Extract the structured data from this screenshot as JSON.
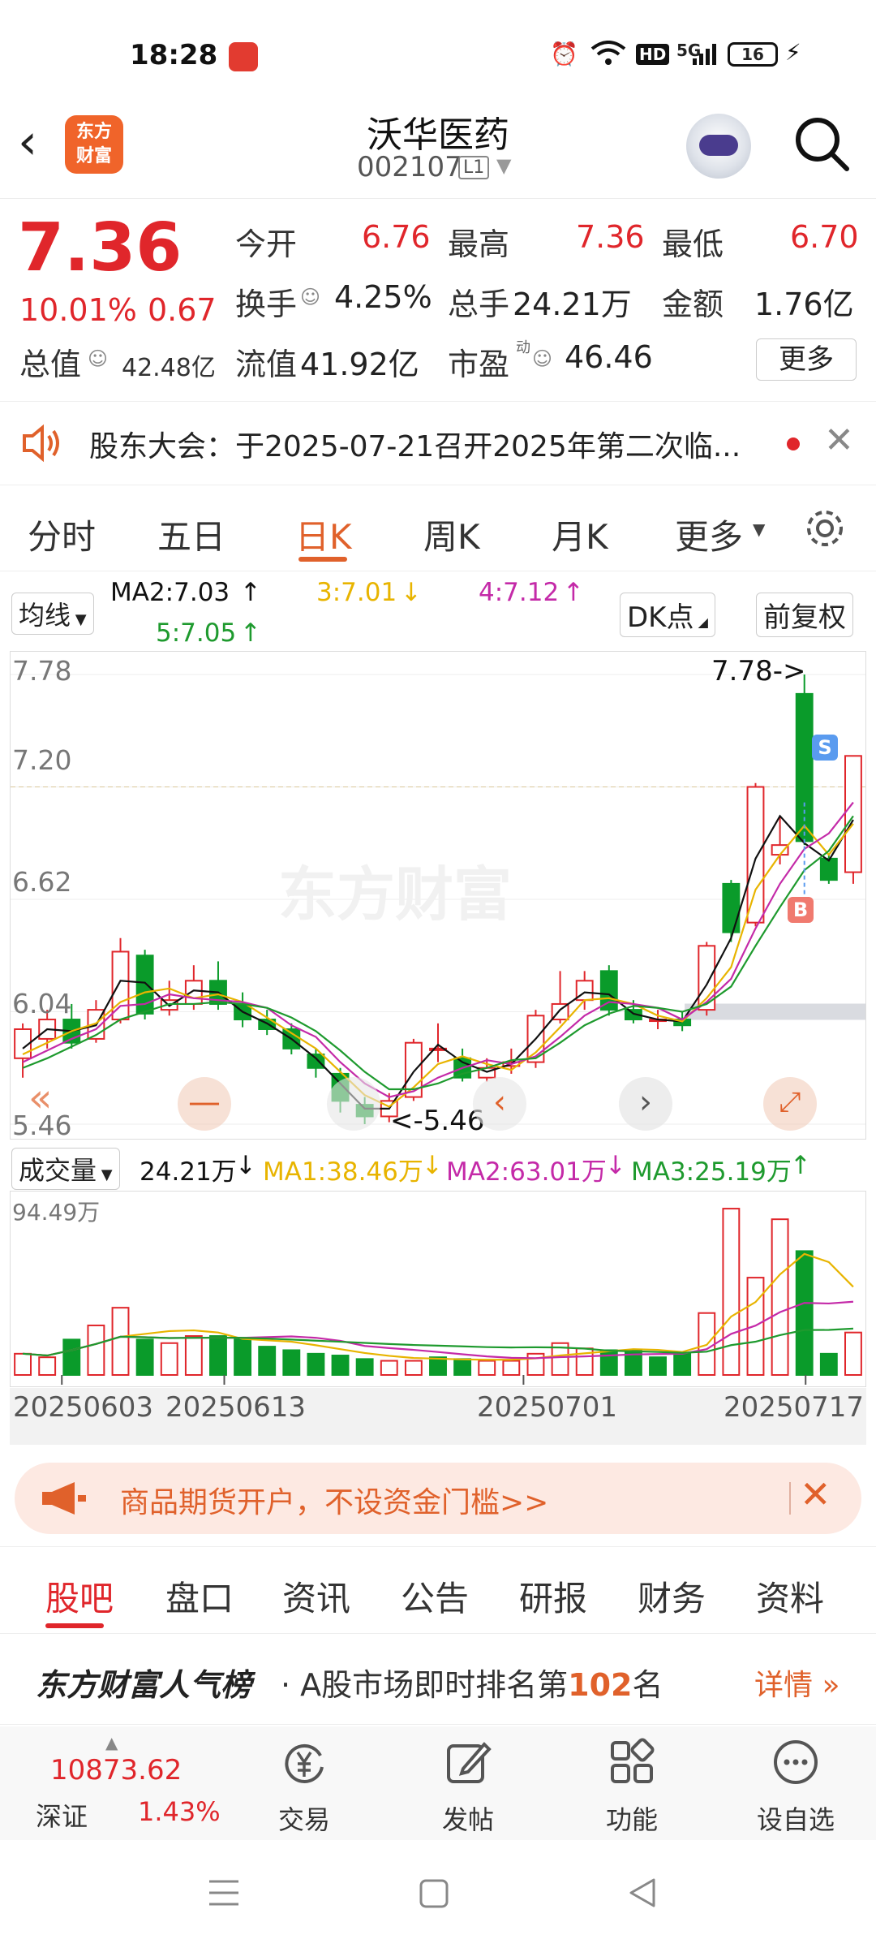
{
  "status_bar": {
    "time": "18:28",
    "network": "5G",
    "hd": "HD",
    "battery": "16"
  },
  "header": {
    "stock_name": "沃华医药",
    "stock_code": "002107",
    "level_badge": "L1",
    "logo_text_1": "东方",
    "logo_text_2": "财富"
  },
  "quote": {
    "price": "7.36",
    "change_pct": "10.01%",
    "change": "0.67",
    "market_cap_label": "总值",
    "market_cap": "42.48亿",
    "open_label": "今开",
    "open": "6.76",
    "high_label": "最高",
    "high": "7.36",
    "low_label": "最低",
    "low": "6.70",
    "turnover_label": "换手",
    "turnover": "4.25%",
    "volume_label": "总手",
    "volume": "24.21万",
    "amount_label": "金额",
    "amount": "1.76亿",
    "float_cap_label": "流值",
    "float_cap": "41.92亿",
    "pe_label": "市盈",
    "pe_sup": "动",
    "pe": "46.46",
    "more_label": "更多"
  },
  "notice": {
    "text": "股东大会：于2025-07-21召开2025年第二次临..."
  },
  "tabs": [
    {
      "label": "分时"
    },
    {
      "label": "五日"
    },
    {
      "label": "日K"
    },
    {
      "label": "周K"
    },
    {
      "label": "月K"
    },
    {
      "label": "更多"
    }
  ],
  "chart_toolbar": {
    "ma_selector": "均线",
    "ma2": "MA2:7.03",
    "ma3": "3:7.01",
    "ma4": "4:7.12",
    "ma5": "5:7.05",
    "dk_button": "DK点",
    "adjust_button": "前复权"
  },
  "chart_data": {
    "type": "candlestick",
    "y_axis_labels": [
      "7.78",
      "7.20",
      "6.62",
      "6.04",
      "5.46"
    ],
    "ylim": [
      5.46,
      7.78
    ],
    "high_marker": "7.78->",
    "low_marker": "<-5.46",
    "buy_marker": "B",
    "sell_marker": "S",
    "watermark": "东方财富",
    "candles": [
      {
        "o": 5.8,
        "c": 5.95,
        "h": 5.98,
        "l": 5.7
      },
      {
        "o": 5.9,
        "c": 6.0,
        "h": 6.05,
        "l": 5.85
      },
      {
        "o": 6.0,
        "c": 5.88,
        "h": 6.08,
        "l": 5.85
      },
      {
        "o": 5.9,
        "c": 6.05,
        "h": 6.1,
        "l": 5.88
      },
      {
        "o": 6.0,
        "c": 6.35,
        "h": 6.42,
        "l": 5.98
      },
      {
        "o": 6.33,
        "c": 6.03,
        "h": 6.36,
        "l": 6.0
      },
      {
        "o": 6.05,
        "c": 6.1,
        "h": 6.2,
        "l": 6.02
      },
      {
        "o": 6.08,
        "c": 6.2,
        "h": 6.28,
        "l": 6.05
      },
      {
        "o": 6.2,
        "c": 6.08,
        "h": 6.3,
        "l": 6.05
      },
      {
        "o": 6.08,
        "c": 6.0,
        "h": 6.14,
        "l": 5.96
      },
      {
        "o": 6.0,
        "c": 5.95,
        "h": 6.05,
        "l": 5.92
      },
      {
        "o": 5.95,
        "c": 5.85,
        "h": 5.98,
        "l": 5.82
      },
      {
        "o": 5.82,
        "c": 5.75,
        "h": 5.85,
        "l": 5.7
      },
      {
        "o": 5.72,
        "c": 5.58,
        "h": 5.75,
        "l": 5.52
      },
      {
        "o": 5.56,
        "c": 5.5,
        "h": 5.6,
        "l": 5.46
      },
      {
        "o": 5.5,
        "c": 5.58,
        "h": 5.62,
        "l": 5.47
      },
      {
        "o": 5.6,
        "c": 5.88,
        "h": 5.9,
        "l": 5.58
      },
      {
        "o": 5.85,
        "c": 5.85,
        "h": 5.98,
        "l": 5.78
      },
      {
        "o": 5.8,
        "c": 5.7,
        "h": 5.85,
        "l": 5.68
      },
      {
        "o": 5.7,
        "c": 5.75,
        "h": 5.8,
        "l": 5.68
      },
      {
        "o": 5.76,
        "c": 5.78,
        "h": 5.85,
        "l": 5.72
      },
      {
        "o": 5.78,
        "c": 6.02,
        "h": 6.05,
        "l": 5.75
      },
      {
        "o": 6.0,
        "c": 6.08,
        "h": 6.25,
        "l": 5.98
      },
      {
        "o": 6.1,
        "c": 6.2,
        "h": 6.25,
        "l": 6.05
      },
      {
        "o": 6.25,
        "c": 6.05,
        "h": 6.28,
        "l": 6.02
      },
      {
        "o": 6.05,
        "c": 6.0,
        "h": 6.1,
        "l": 5.98
      },
      {
        "o": 6.0,
        "c": 6.0,
        "h": 6.05,
        "l": 5.95
      },
      {
        "o": 6.0,
        "c": 5.97,
        "h": 6.04,
        "l": 5.94
      },
      {
        "o": 6.05,
        "c": 6.38,
        "h": 6.4,
        "l": 6.02
      },
      {
        "o": 6.7,
        "c": 6.45,
        "h": 6.72,
        "l": 6.4
      },
      {
        "o": 6.5,
        "c": 7.2,
        "h": 7.22,
        "l": 6.48
      },
      {
        "o": 6.85,
        "c": 6.9,
        "h": 7.05,
        "l": 6.8
      },
      {
        "o": 7.68,
        "c": 6.92,
        "h": 7.78,
        "l": 6.9
      },
      {
        "o": 6.83,
        "c": 6.72,
        "h": 6.85,
        "l": 6.7
      },
      {
        "o": 6.76,
        "c": 7.36,
        "h": 7.36,
        "l": 6.7
      }
    ],
    "ma_series": [
      {
        "name": "MA2",
        "color": "#111111",
        "values": [
          5.85,
          5.95,
          5.94,
          5.97,
          6.2,
          6.19,
          6.07,
          6.15,
          6.14,
          6.04,
          5.98,
          5.9,
          5.8,
          5.67,
          5.54,
          5.54,
          5.73,
          5.87,
          5.78,
          5.73,
          5.77,
          5.9,
          6.05,
          6.14,
          6.13,
          6.03,
          6.0,
          5.99,
          6.18,
          6.42,
          6.83,
          7.05,
          6.91,
          6.82,
          7.03
        ]
      },
      {
        "name": "MA3",
        "color": "#e8b400",
        "values": [
          5.82,
          5.88,
          5.94,
          5.98,
          6.09,
          6.14,
          6.16,
          6.11,
          6.13,
          6.09,
          6.01,
          5.93,
          5.85,
          5.73,
          5.61,
          5.55,
          5.65,
          5.77,
          5.81,
          5.77,
          5.74,
          5.83,
          5.96,
          6.1,
          6.11,
          6.08,
          6.02,
          5.99,
          6.11,
          6.27,
          6.67,
          6.85,
          7.0,
          6.85,
          7.01
        ]
      },
      {
        "name": "MA4",
        "color": "#c42aa8",
        "values": [
          5.78,
          5.84,
          5.9,
          5.95,
          6.07,
          6.08,
          6.13,
          6.11,
          6.1,
          6.09,
          6.06,
          5.97,
          5.91,
          5.78,
          5.67,
          5.6,
          5.63,
          5.7,
          5.75,
          5.79,
          5.77,
          5.81,
          5.91,
          6.02,
          6.09,
          6.08,
          6.06,
          6.0,
          6.09,
          6.21,
          6.47,
          6.7,
          6.88,
          6.96,
          7.12
        ]
      },
      {
        "name": "MA5",
        "color": "#1e9a2e",
        "values": [
          5.75,
          5.8,
          5.86,
          5.92,
          6.0,
          6.04,
          6.08,
          6.08,
          6.09,
          6.08,
          6.06,
          6.01,
          5.94,
          5.84,
          5.73,
          5.64,
          5.64,
          5.67,
          5.72,
          5.75,
          5.79,
          5.8,
          5.88,
          5.97,
          6.03,
          6.07,
          6.06,
          6.04,
          6.08,
          6.17,
          6.38,
          6.58,
          6.77,
          6.87,
          7.05
        ]
      }
    ],
    "dates": [
      "20250603",
      "20250613",
      "20250701",
      "20250717"
    ]
  },
  "volume": {
    "selector": "成交量",
    "current": "24.21万",
    "ma1": "MA1:38.46万",
    "ma2": "MA2:63.01万",
    "ma3": "MA3:25.19万",
    "max_label": "94.49万",
    "values": [
      12,
      10,
      20,
      28,
      38,
      20,
      18,
      22,
      22,
      20,
      16,
      14,
      12,
      11,
      9,
      8,
      8,
      10,
      9,
      8,
      8,
      12,
      18,
      15,
      14,
      14,
      10,
      12,
      35,
      94,
      55,
      88,
      70,
      12,
      24
    ],
    "up": [
      true,
      true,
      false,
      true,
      true,
      false,
      true,
      true,
      false,
      false,
      false,
      false,
      false,
      false,
      false,
      true,
      true,
      false,
      false,
      true,
      true,
      true,
      true,
      true,
      false,
      false,
      false,
      false,
      true,
      true,
      true,
      true,
      false,
      false,
      true
    ]
  },
  "promo": {
    "text": "商品期货开户，不设资金门槛>>"
  },
  "bottom_tabs": [
    {
      "label": "股吧"
    },
    {
      "label": "盘口"
    },
    {
      "label": "资讯"
    },
    {
      "label": "公告"
    },
    {
      "label": "研报"
    },
    {
      "label": "财务"
    },
    {
      "label": "资料"
    }
  ],
  "rank": {
    "brand": "东方财富人气榜",
    "prefix": "· A股市场即时排名第",
    "num": "102",
    "suffix": "名",
    "detail": "详情"
  },
  "bottom_nav": {
    "index_value": "10873.62",
    "index_name": "深证",
    "index_pct": "1.43%",
    "items": [
      {
        "label": "交易"
      },
      {
        "label": "发帖"
      },
      {
        "label": "功能"
      },
      {
        "label": "设自选"
      }
    ]
  },
  "colors": {
    "up": "#e0262b",
    "down": "#0a9b2a",
    "accent": "#e0612b"
  }
}
